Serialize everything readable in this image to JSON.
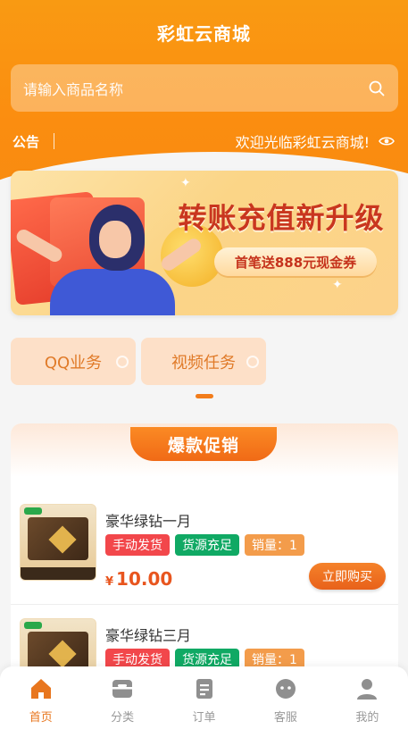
{
  "header": {
    "title": "彩虹云商城"
  },
  "search": {
    "placeholder": "请输入商品名称"
  },
  "notice": {
    "label": "公告",
    "text": "欢迎光临彩虹云商城!"
  },
  "banner": {
    "headline": "转账充值新升级",
    "subline": "首笔送888元现金券"
  },
  "categories": [
    {
      "label": "QQ业务"
    },
    {
      "label": "视频任务"
    }
  ],
  "promo": {
    "title": "爆款促销",
    "currency": "¥",
    "buy_label": "立即购买",
    "items": [
      {
        "name": "豪华绿钻一月",
        "tags": [
          "手动发货",
          "货源充足",
          "销量：1"
        ],
        "price": "10.00"
      },
      {
        "name": "豪华绿钻三月",
        "tags": [
          "手动发货",
          "货源充足",
          "销量：1"
        ],
        "price": ""
      }
    ]
  },
  "tabbar": [
    {
      "label": "首页",
      "icon": "home-icon",
      "active": true
    },
    {
      "label": "分类",
      "icon": "category-icon"
    },
    {
      "label": "订单",
      "icon": "order-icon"
    },
    {
      "label": "客服",
      "icon": "service-icon"
    },
    {
      "label": "我的",
      "icon": "user-icon"
    }
  ],
  "colors": {
    "accent": "#f58a12",
    "promo_tag": "#f06a16",
    "price": "#e8551e",
    "badge_red": "#f2474b",
    "badge_green": "#10a964",
    "badge_orange": "#f39c4b"
  }
}
